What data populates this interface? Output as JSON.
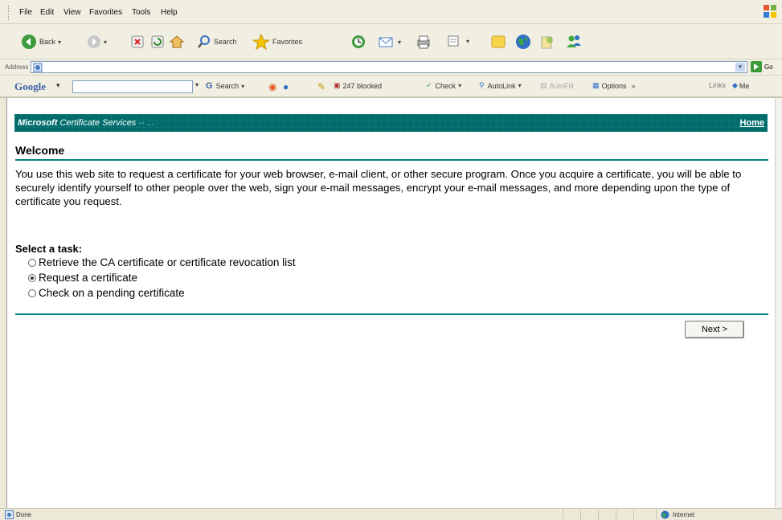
{
  "menubar": {
    "items": [
      "File",
      "Edit",
      "View",
      "Favorites",
      "Tools",
      "Help"
    ]
  },
  "toolbar": {
    "back_label": "Back",
    "search_label": "Search",
    "favorites_label": "Favorites"
  },
  "addressbar": {
    "label": "Address",
    "value": "",
    "go_label": "Go"
  },
  "googlebar": {
    "logo": "Google",
    "search_label": "Search",
    "blocked_label": "247 blocked",
    "check_label": "Check",
    "autolink_label": "AutoLink",
    "autofill_label": "AutoFill",
    "options_label": "Options",
    "more_label": "»",
    "links_label": "Links",
    "me_label": "Me"
  },
  "page": {
    "header_title_bold": "Microsoft",
    "header_title": " Certificate Services",
    "header_suffix": "-- ...",
    "home_link": "Home",
    "welcome_heading": "Welcome",
    "intro_text": "You use this web site to request a certificate for your web browser, e-mail client, or other secure program. Once you acquire a certificate, you will be able to securely identify yourself to other people over the web, sign your e-mail messages, encrypt your e-mail messages, and more depending upon the type of certificate you request.",
    "task_label": "Select a task:",
    "options": [
      {
        "label": "Retrieve the CA certificate or certificate revocation list",
        "selected": false
      },
      {
        "label": "Request a certificate",
        "selected": true
      },
      {
        "label": "Check on a pending certificate",
        "selected": false
      }
    ],
    "next_button": "Next >"
  },
  "statusbar": {
    "left_text": "Done",
    "zone_text": "Internet"
  },
  "colors": {
    "header_bg": "#006c6c",
    "rule": "#008080"
  }
}
